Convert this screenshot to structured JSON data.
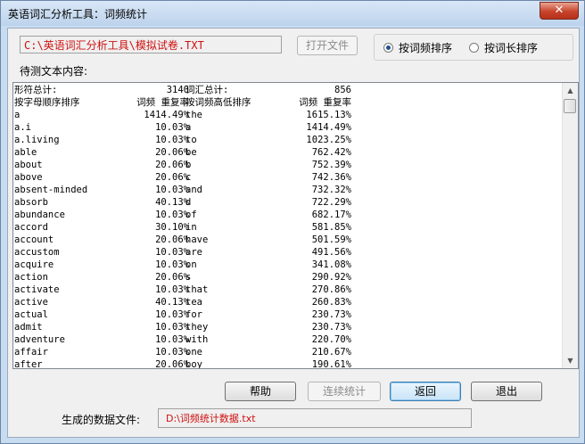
{
  "window": {
    "title": "英语词汇分析工具：词频统计",
    "close_glyph": "✕"
  },
  "toolbar": {
    "file_path": "C:\\英语词汇分析工具\\模拟试卷.TXT",
    "open_file_label": "打开文件",
    "sort_by_frequency_label": "按词频排序",
    "sort_by_length_label": "按词长排序",
    "selected_sort": "frequency"
  },
  "text_label": "待测文本内容:",
  "summary": {
    "tokens_label": "形符总计:",
    "tokens_value": "3140",
    "vocab_label": "词汇总计:",
    "vocab_value": "856"
  },
  "headers": {
    "alpha_sort": "按字母顺序排序",
    "freq": "词频 重复率",
    "freq_sort": "按词频高低排序",
    "freq2": "词频 重复率"
  },
  "rows": [
    [
      "a",
      "1414.49%",
      "the",
      "1615.13%"
    ],
    [
      "a.i",
      "10.03%",
      "a",
      "1414.49%"
    ],
    [
      "a.living",
      "10.03%",
      "to",
      "1023.25%"
    ],
    [
      "able",
      "20.06%",
      "be",
      "762.42%"
    ],
    [
      "about",
      "20.06%",
      "b",
      "752.39%"
    ],
    [
      "above",
      "20.06%",
      "c",
      "742.36%"
    ],
    [
      "absent-minded",
      "10.03%",
      "and",
      "732.32%"
    ],
    [
      "absorb",
      "40.13%",
      "d",
      "722.29%"
    ],
    [
      "abundance",
      "10.03%",
      "of",
      "682.17%"
    ],
    [
      "accord",
      "30.10%",
      "in",
      "581.85%"
    ],
    [
      "account",
      "20.06%",
      "have",
      "501.59%"
    ],
    [
      "accustom",
      "10.03%",
      "are",
      "491.56%"
    ],
    [
      "acquire",
      "10.03%",
      "on",
      "341.08%"
    ],
    [
      "action",
      "20.06%",
      "s",
      "290.92%"
    ],
    [
      "activate",
      "10.03%",
      "that",
      "270.86%"
    ],
    [
      "active",
      "40.13%",
      "tea",
      "260.83%"
    ],
    [
      "actual",
      "10.03%",
      "for",
      "230.73%"
    ],
    [
      "admit",
      "10.03%",
      "they",
      "230.73%"
    ],
    [
      "adventure",
      "10.03%",
      "with",
      "220.70%"
    ],
    [
      "affair",
      "10.03%",
      "one",
      "210.67%"
    ],
    [
      "after",
      "20.06%",
      "boy",
      "190.61%"
    ]
  ],
  "buttons": {
    "help": "帮助",
    "continuous": "连续统计",
    "back": "返回",
    "exit": "退出"
  },
  "output": {
    "label": "生成的数据文件:",
    "path": "D:\\词频统计数据.txt"
  },
  "colors": {
    "path_text": "#d01010",
    "title_bg": "#c8dcf0",
    "close_btn": "#c7432a"
  }
}
